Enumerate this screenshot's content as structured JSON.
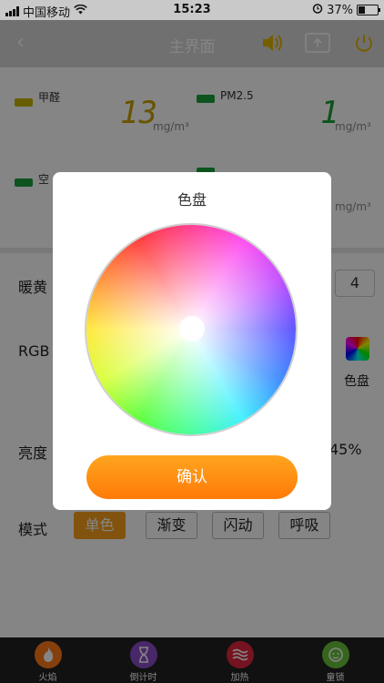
{
  "status_bar": {
    "carrier": "中国移动",
    "time": "15:23",
    "battery": "37%"
  },
  "nav": {
    "back": "‹",
    "title": "主界面"
  },
  "sensors": [
    {
      "label": "甲醛",
      "value": "13",
      "unit": "mg/m³",
      "color": "#c8b400"
    },
    {
      "label": "PM2.5",
      "value": "1",
      "unit": "mg/m³",
      "color": "#1aa03a"
    },
    {
      "label": "空",
      "unit": "mg/m³",
      "color": "#1aa03a"
    }
  ],
  "controls": {
    "warm_label": "暖黄 L",
    "warm_value": "4",
    "rgb_label": "RGB",
    "palette_label": "色盘",
    "brightness_label": "亮度",
    "brightness_value": "45%",
    "mode_label": "模式",
    "modes": [
      "单色",
      "渐变",
      "闪动",
      "呼吸"
    ]
  },
  "tabs": [
    {
      "label": "火焰",
      "icon": "flame-icon",
      "color": "#ff7a1a"
    },
    {
      "label": "倒计时",
      "icon": "hourglass-icon",
      "color": "#8a4ec7"
    },
    {
      "label": "加热",
      "icon": "heat-waves-icon",
      "color": "#e0283f"
    },
    {
      "label": "童锁",
      "icon": "child-face-icon",
      "color": "#69c23a"
    }
  ],
  "dialog": {
    "title": "色盘",
    "confirm_label": "确认"
  }
}
